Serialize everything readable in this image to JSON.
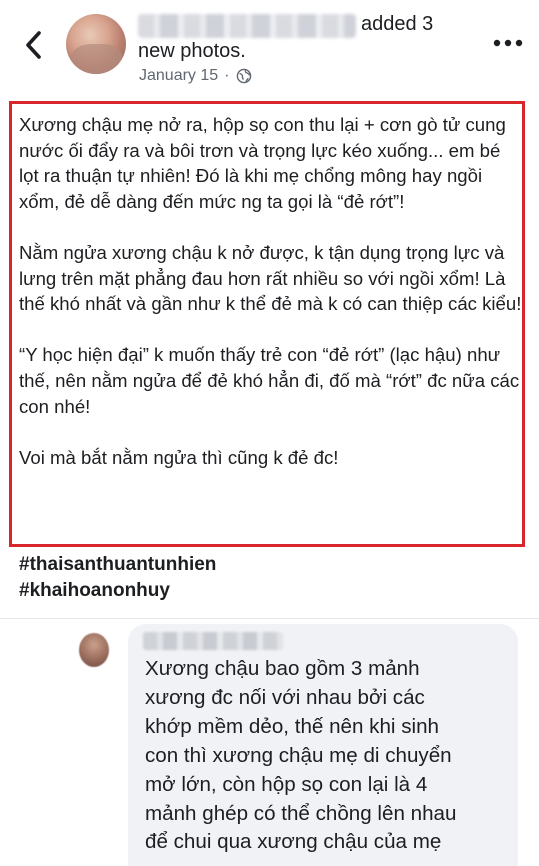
{
  "header": {
    "action_line1": "added 3",
    "action_line2": "new photos.",
    "date": "January 15",
    "separator": "·"
  },
  "post": {
    "paragraphs": [
      "Xương chậu mẹ nở ra, hộp sọ con thu lại + cơn gò tử cung nước ối đẩy ra và bôi trơn và trọng lực kéo xuống... em bé lọt ra thuận tự nhiên!  Đó là khi mẹ chổng mông hay ngồi xổm, đẻ dễ dàng đến mức ng ta gọi là “đẻ rớt”!",
      "Nằm ngửa xương chậu k nở được, k tận dụng trọng lực và lưng trên mặt phẳng đau hơn rất nhiều so với ngồi xổm!  Là thế khó nhất và gần như k thể đẻ mà k có can thiệp các kiểu!",
      "“Y học hiện đại” k muốn thấy trẻ con “đẻ rớt” (lạc hậu) như thế, nên nằm ngửa để đẻ khó hẳn đi, đố mà “rớt” đc nữa các con nhé!",
      "Voi mà bắt nằm ngửa thì cũng k đẻ đc!"
    ],
    "hashtags": [
      "#thaisanthuantunhien",
      "#khaihoanonhuy"
    ]
  },
  "comment": {
    "lines": [
      "Xương chậu bao gồm 3 mảnh",
      "xương đc nối với nhau bởi các",
      "khớp mềm dẻo, thế nên khi sinh",
      "con thì xương chậu mẹ di chuyển",
      "mở lớn, còn hộp sọ con lại là 4",
      "mảnh ghép có thể chồng lên nhau",
      "để chui qua xương chậu của mẹ"
    ]
  },
  "icons": {
    "back": "chevron-left-icon",
    "more": "more-dots-icon",
    "privacy": "globe-icon"
  },
  "colors": {
    "highlight_border": "#d9262c",
    "comment_bg": "#f0f2f5",
    "meta_text": "#606770"
  }
}
